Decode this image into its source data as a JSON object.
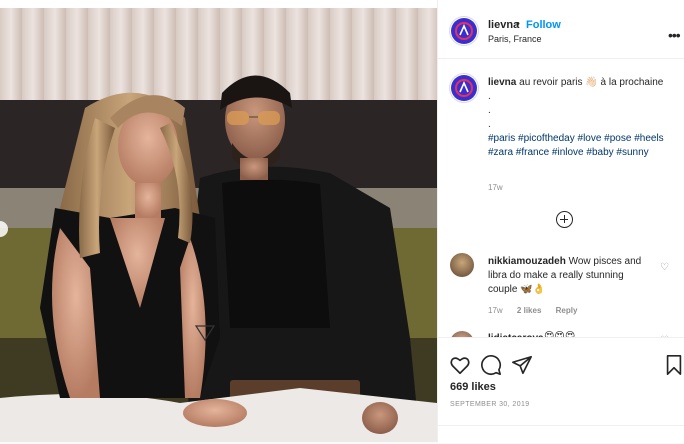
{
  "post": {
    "username": "lievna",
    "dot": "•",
    "follow_label": "Follow",
    "location": "Paris, France",
    "more_label": "•••",
    "caption_text": "au revoir paris 👋🏻 à la prochaine",
    "caption_dots": [
      ".",
      ".",
      "."
    ],
    "hashtags": "#paris #picoftheday #love #pose #heels #zara #france #inlove #baby #sunny",
    "caption_time": "17w",
    "comments": [
      {
        "username": "nikkiamouzadeh",
        "text": "Wow pisces and libra do make a really stunning couple 🦋👌",
        "time": "17w",
        "likes": "2 likes",
        "reply": "Reply"
      },
      {
        "username": "lidiatcarova",
        "text": "😍😍😍"
      }
    ],
    "likes": "669 likes",
    "date": "SEPTEMBER 30, 2019"
  },
  "icons": {
    "heart": "heart-icon",
    "comment": "comment-icon",
    "share": "share-icon",
    "save": "bookmark-icon",
    "load_more": "plus-circle-icon"
  },
  "colors": {
    "link": "#0095f6",
    "hashtag": "#00376b",
    "muted": "#8e8e8e",
    "avatar_ring": "#3b2ed1",
    "avatar_mark": "#e2345a"
  }
}
